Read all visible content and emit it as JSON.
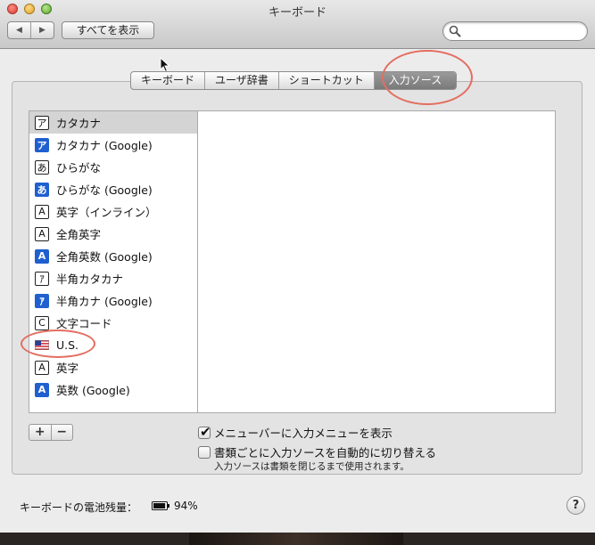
{
  "window": {
    "title": "キーボード"
  },
  "toolbar": {
    "back_glyph": "◀",
    "forward_glyph": "▶",
    "show_all_label": "すべてを表示",
    "search_value": ""
  },
  "tabs": [
    {
      "label": "キーボード",
      "active": false
    },
    {
      "label": "ユーザ辞書",
      "active": false
    },
    {
      "label": "ショートカット",
      "active": false
    },
    {
      "label": "入力ソース",
      "active": true
    }
  ],
  "input_sources": {
    "items": [
      {
        "label": "カタカナ",
        "icon": "katakana-icon",
        "glyph": "ア",
        "style": "outline",
        "selected": true
      },
      {
        "label": "カタカナ (Google)",
        "icon": "katakana-google-icon",
        "glyph": "ア",
        "style": "filled",
        "selected": false
      },
      {
        "label": "ひらがな",
        "icon": "hiragana-icon",
        "glyph": "あ",
        "style": "outline",
        "selected": false
      },
      {
        "label": "ひらがな (Google)",
        "icon": "hiragana-google-icon",
        "glyph": "あ",
        "style": "filled",
        "selected": false
      },
      {
        "label": "英字（インライン）",
        "icon": "alphanumeric-inline-icon",
        "glyph": "A",
        "style": "outline",
        "selected": false
      },
      {
        "label": "全角英字",
        "icon": "fullwidth-alphanumeric-icon",
        "glyph": "A",
        "style": "outline",
        "selected": false
      },
      {
        "label": "全角英数 (Google)",
        "icon": "fullwidth-alphanumeric-google-icon",
        "glyph": "A",
        "style": "filled",
        "selected": false
      },
      {
        "label": "半角カタカナ",
        "icon": "halfwidth-katakana-icon",
        "glyph": "ｱ",
        "style": "outline",
        "selected": false
      },
      {
        "label": "半角カナ (Google)",
        "icon": "halfwidth-kana-google-icon",
        "glyph": "ｱ",
        "style": "filled",
        "selected": false
      },
      {
        "label": "文字コード",
        "icon": "character-code-icon",
        "glyph": "C",
        "style": "outline",
        "selected": false
      },
      {
        "label": "U.S.",
        "icon": "us-flag-icon",
        "glyph": "",
        "style": "flag",
        "selected": false
      },
      {
        "label": "英字",
        "icon": "alphanumeric-icon",
        "glyph": "A",
        "style": "outline",
        "selected": false
      },
      {
        "label": "英数 (Google)",
        "icon": "alphanumeric-google-icon",
        "glyph": "A",
        "style": "filled",
        "selected": false
      }
    ],
    "add_label": "+",
    "remove_label": "−"
  },
  "options": {
    "show_menu": {
      "label": "メニューバーに入力メニューを表示",
      "checked": true,
      "check_glyph": "✔"
    },
    "auto_switch": {
      "label": "書類ごとに入力ソースを自動的に切り替える",
      "checked": false
    },
    "note": "入力ソースは書類を閉じるまで使用されます。"
  },
  "footer": {
    "battery_label": "キーボードの電池残量：",
    "battery_level": 0.94,
    "battery_percent": "94%",
    "help_label": "?"
  },
  "colors": {
    "selection": "#d4d4d4",
    "filled_icon": "#1f5fcf",
    "callout": "#e46e60",
    "active_tab": "#8a8a8a"
  }
}
